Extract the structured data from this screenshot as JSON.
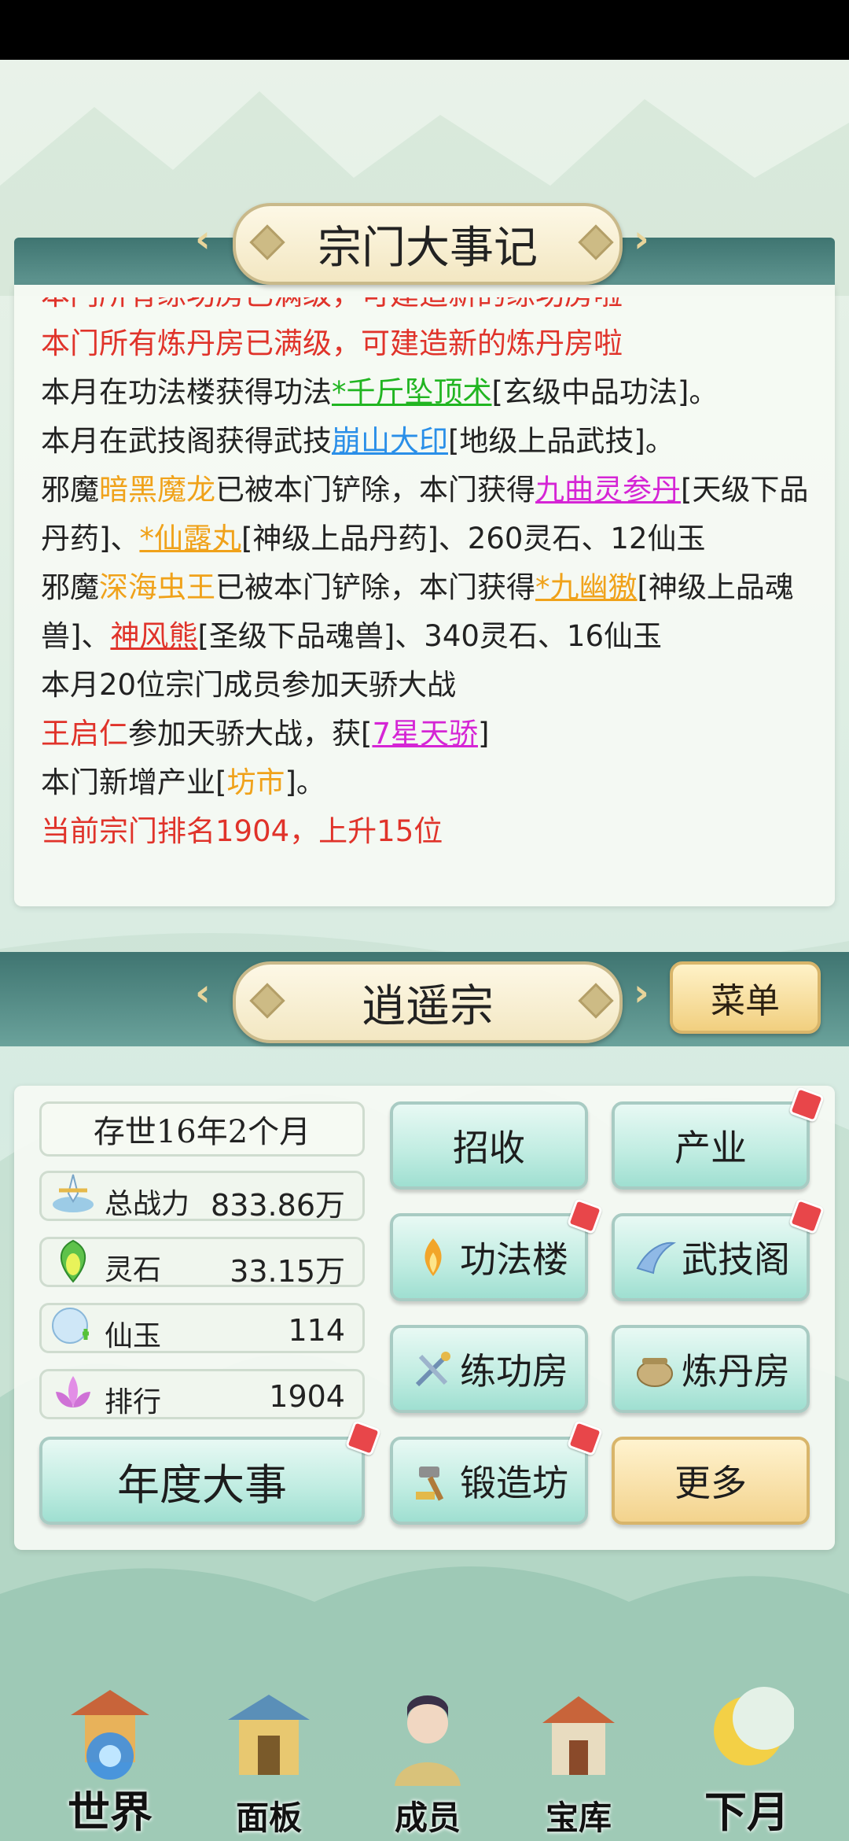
{
  "chronicle": {
    "title": "宗门大事记",
    "cut_line": "本门所有练功房已满级，可建造新的练功房啦",
    "lines": {
      "l1": "本门所有炼丹房已满级，可建造新的炼丹房啦",
      "l2_a": "本月在功法楼获得功法",
      "l2_b": "*千斤坠顶术",
      "l2_c": "[玄级中品功法]。",
      "l3_a": "本月在武技阁获得武技",
      "l3_b": "崩山大印",
      "l3_c": "[地级上品武技]。",
      "l4_a": "邪魔",
      "l4_b": "暗黑魔龙",
      "l4_c": "已被本门铲除，本门获得",
      "l4_d": "九曲灵参丹",
      "l4_e": "[天级下品丹药]、",
      "l4_f": "*仙露丸",
      "l4_g": "[神级上品丹药]、260灵石、12仙玉",
      "l5_a": "邪魔",
      "l5_b": "深海虫王",
      "l5_c": "已被本门铲除，本门获得",
      "l5_d": "*九幽獓",
      "l5_e": "[神级上品魂兽]、",
      "l5_f": "神风熊",
      "l5_g": "[圣级下品魂兽]、340灵石、16仙玉",
      "l6": "本月20位宗门成员参加天骄大战",
      "l7_a": "王启仁",
      "l7_b": "参加天骄大战，获[",
      "l7_c": "7星天骄",
      "l7_d": "]",
      "l8_a": "本门新增产业[",
      "l8_b": "坊市",
      "l8_c": "]。",
      "l9": "当前宗门排名1904，上升15位"
    }
  },
  "sect": {
    "name": "逍遥宗",
    "menu_label": "菜单",
    "age": "存世16年2个月",
    "stats": [
      {
        "label": "总战力",
        "value": "833.86万",
        "icon": "sword-power-icon"
      },
      {
        "label": "灵石",
        "value": "33.15万",
        "icon": "spirit-stone-icon"
      },
      {
        "label": "仙玉",
        "value": "114",
        "icon": "jade-icon"
      },
      {
        "label": "排行",
        "value": "1904",
        "icon": "lotus-rank-icon"
      }
    ],
    "buttons": {
      "recruit": "招收",
      "industry": "产业",
      "skill_tower": "功法楼",
      "martial_pavilion": "武技阁",
      "training_room": "练功房",
      "alchemy_room": "炼丹房",
      "annual_events": "年度大事",
      "forge": "锻造坊",
      "more": "更多"
    }
  },
  "nav": {
    "world": "世界",
    "panel": "面板",
    "members": "成员",
    "treasury": "宝库",
    "next_month": "下月"
  }
}
